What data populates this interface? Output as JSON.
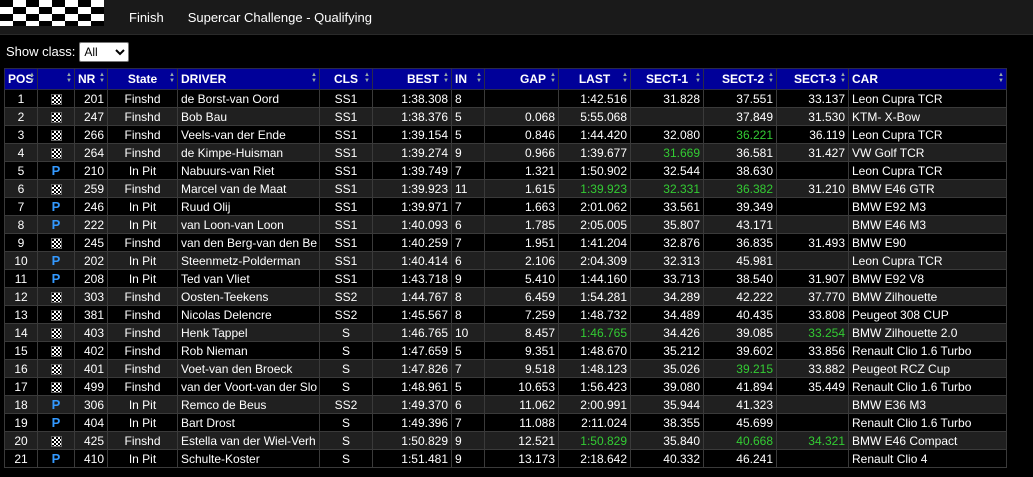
{
  "header": {
    "status": "Finish",
    "event": "Supercar Challenge - Qualifying"
  },
  "filter": {
    "label": "Show class:",
    "selected": "All"
  },
  "columns": [
    "POS",
    "",
    "NR",
    "State",
    "DRIVER",
    "CLS",
    "BEST",
    "IN",
    "GAP",
    "LAST",
    "SECT-1",
    "SECT-2",
    "SECT-3",
    "CAR"
  ],
  "rows": [
    {
      "pos": "1",
      "flag": "finish",
      "nr": "201",
      "state": "Finshd",
      "driver": "de Borst-van Oord",
      "cls": "SS1",
      "best": "1:38.308",
      "in": "8",
      "gap": "",
      "last": "1:42.516",
      "s1": "31.828",
      "s2": "37.551",
      "s3": "33.137",
      "car": "Leon Cupra TCR",
      "g": []
    },
    {
      "pos": "2",
      "flag": "finish",
      "nr": "247",
      "state": "Finshd",
      "driver": "Bob Bau",
      "cls": "SS1",
      "best": "1:38.376",
      "in": "5",
      "gap": "0.068",
      "last": "5:55.068",
      "s1": "",
      "s2": "37.849",
      "s3": "31.530",
      "car": "KTM- X-Bow",
      "g": []
    },
    {
      "pos": "3",
      "flag": "finish",
      "nr": "266",
      "state": "Finshd",
      "driver": "Veels-van der Ende",
      "cls": "SS1",
      "best": "1:39.154",
      "in": "5",
      "gap": "0.846",
      "last": "1:44.420",
      "s1": "32.080",
      "s2": "36.221",
      "s3": "36.119",
      "car": "Leon Cupra TCR",
      "g": [
        "s2"
      ]
    },
    {
      "pos": "4",
      "flag": "finish",
      "nr": "264",
      "state": "Finshd",
      "driver": "de Kimpe-Huisman",
      "cls": "SS1",
      "best": "1:39.274",
      "in": "9",
      "gap": "0.966",
      "last": "1:39.677",
      "s1": "31.669",
      "s2": "36.581",
      "s3": "31.427",
      "car": "VW Golf TCR",
      "g": [
        "s1"
      ]
    },
    {
      "pos": "5",
      "flag": "pit",
      "nr": "210",
      "state": "In Pit",
      "driver": "Nabuurs-van Riet",
      "cls": "SS1",
      "best": "1:39.749",
      "in": "7",
      "gap": "1.321",
      "last": "1:50.902",
      "s1": "32.544",
      "s2": "38.630",
      "s3": "",
      "car": "Leon Cupra TCR",
      "g": []
    },
    {
      "pos": "6",
      "flag": "finish",
      "nr": "259",
      "state": "Finshd",
      "driver": "Marcel van de Maat",
      "cls": "SS1",
      "best": "1:39.923",
      "in": "11",
      "gap": "1.615",
      "last": "1:39.923",
      "s1": "32.331",
      "s2": "36.382",
      "s3": "31.210",
      "car": "BMW E46 GTR",
      "g": [
        "last",
        "s1",
        "s2"
      ]
    },
    {
      "pos": "7",
      "flag": "pit",
      "nr": "246",
      "state": "In Pit",
      "driver": "Ruud Olij",
      "cls": "SS1",
      "best": "1:39.971",
      "in": "7",
      "gap": "1.663",
      "last": "2:01.062",
      "s1": "33.561",
      "s2": "39.349",
      "s3": "",
      "car": "BMW E92 M3",
      "g": []
    },
    {
      "pos": "8",
      "flag": "pit",
      "nr": "222",
      "state": "In Pit",
      "driver": "van Loon-van Loon",
      "cls": "SS1",
      "best": "1:40.093",
      "in": "6",
      "gap": "1.785",
      "last": "2:05.005",
      "s1": "35.807",
      "s2": "43.171",
      "s3": "",
      "car": "BMW E46 M3",
      "g": []
    },
    {
      "pos": "9",
      "flag": "finish",
      "nr": "245",
      "state": "Finshd",
      "driver": "van den Berg-van den Be",
      "cls": "SS1",
      "best": "1:40.259",
      "in": "7",
      "gap": "1.951",
      "last": "1:41.204",
      "s1": "32.876",
      "s2": "36.835",
      "s3": "31.493",
      "car": "BMW E90",
      "g": []
    },
    {
      "pos": "10",
      "flag": "pit",
      "nr": "202",
      "state": "In Pit",
      "driver": "Steenmetz-Polderman",
      "cls": "SS1",
      "best": "1:40.414",
      "in": "6",
      "gap": "2.106",
      "last": "2:04.309",
      "s1": "32.313",
      "s2": "45.981",
      "s3": "",
      "car": "Leon Cupra TCR",
      "g": []
    },
    {
      "pos": "11",
      "flag": "pit",
      "nr": "208",
      "state": "In Pit",
      "driver": "Ted van Vliet",
      "cls": "SS1",
      "best": "1:43.718",
      "in": "9",
      "gap": "5.410",
      "last": "1:44.160",
      "s1": "33.713",
      "s2": "38.540",
      "s3": "31.907",
      "car": "BMW E92 V8",
      "g": []
    },
    {
      "pos": "12",
      "flag": "finish",
      "nr": "303",
      "state": "Finshd",
      "driver": "Oosten-Teekens",
      "cls": "SS2",
      "best": "1:44.767",
      "in": "8",
      "gap": "6.459",
      "last": "1:54.281",
      "s1": "34.289",
      "s2": "42.222",
      "s3": "37.770",
      "car": "BMW Zilhouette",
      "g": []
    },
    {
      "pos": "13",
      "flag": "finish",
      "nr": "381",
      "state": "Finshd",
      "driver": "Nicolas Delencre",
      "cls": "SS2",
      "best": "1:45.567",
      "in": "8",
      "gap": "7.259",
      "last": "1:48.732",
      "s1": "34.489",
      "s2": "40.435",
      "s3": "33.808",
      "car": "Peugeot 308 CUP",
      "g": []
    },
    {
      "pos": "14",
      "flag": "finish",
      "nr": "403",
      "state": "Finshd",
      "driver": "Henk Tappel",
      "cls": "S",
      "best": "1:46.765",
      "in": "10",
      "gap": "8.457",
      "last": "1:46.765",
      "s1": "34.426",
      "s2": "39.085",
      "s3": "33.254",
      "car": "BMW Zilhouette 2.0",
      "g": [
        "last",
        "s3"
      ]
    },
    {
      "pos": "15",
      "flag": "finish",
      "nr": "402",
      "state": "Finshd",
      "driver": "Rob Nieman",
      "cls": "S",
      "best": "1:47.659",
      "in": "5",
      "gap": "9.351",
      "last": "1:48.670",
      "s1": "35.212",
      "s2": "39.602",
      "s3": "33.856",
      "car": "Renault Clio 1.6 Turbo",
      "g": []
    },
    {
      "pos": "16",
      "flag": "finish",
      "nr": "401",
      "state": "Finshd",
      "driver": "Voet-van den Broeck",
      "cls": "S",
      "best": "1:47.826",
      "in": "7",
      "gap": "9.518",
      "last": "1:48.123",
      "s1": "35.026",
      "s2": "39.215",
      "s3": "33.882",
      "car": "Peugeot RCZ Cup",
      "g": [
        "s2"
      ]
    },
    {
      "pos": "17",
      "flag": "finish",
      "nr": "499",
      "state": "Finshd",
      "driver": "van der Voort-van der Slo",
      "cls": "S",
      "best": "1:48.961",
      "in": "5",
      "gap": "10.653",
      "last": "1:56.423",
      "s1": "39.080",
      "s2": "41.894",
      "s3": "35.449",
      "car": "Renault Clio 1.6 Turbo",
      "g": []
    },
    {
      "pos": "18",
      "flag": "pit",
      "nr": "306",
      "state": "In Pit",
      "driver": "Remco de Beus",
      "cls": "SS2",
      "best": "1:49.370",
      "in": "6",
      "gap": "11.062",
      "last": "2:00.991",
      "s1": "35.944",
      "s2": "41.323",
      "s3": "",
      "car": "BMW E36 M3",
      "g": []
    },
    {
      "pos": "19",
      "flag": "pit",
      "nr": "404",
      "state": "In Pit",
      "driver": "Bart Drost",
      "cls": "S",
      "best": "1:49.396",
      "in": "7",
      "gap": "11.088",
      "last": "2:11.024",
      "s1": "38.355",
      "s2": "45.699",
      "s3": "",
      "car": "Renault Clio 1.6 Turbo",
      "g": []
    },
    {
      "pos": "20",
      "flag": "finish",
      "nr": "425",
      "state": "Finshd",
      "driver": "Estella van der Wiel-Verh",
      "cls": "S",
      "best": "1:50.829",
      "in": "9",
      "gap": "12.521",
      "last": "1:50.829",
      "s1": "35.840",
      "s2": "40.668",
      "s3": "34.321",
      "car": "BMW E46 Compact",
      "g": [
        "last",
        "s2",
        "s3"
      ]
    },
    {
      "pos": "21",
      "flag": "pit",
      "nr": "410",
      "state": "In Pit",
      "driver": "Schulte-Koster",
      "cls": "S",
      "best": "1:51.481",
      "in": "9",
      "gap": "13.173",
      "last": "2:18.642",
      "s1": "40.332",
      "s2": "46.241",
      "s3": "",
      "car": "Renault Clio 4",
      "g": []
    }
  ],
  "pit_symbol": "P",
  "colors": {
    "header_bg": "#000099",
    "highlight": "#33cc33",
    "pit": "#3399ff"
  }
}
